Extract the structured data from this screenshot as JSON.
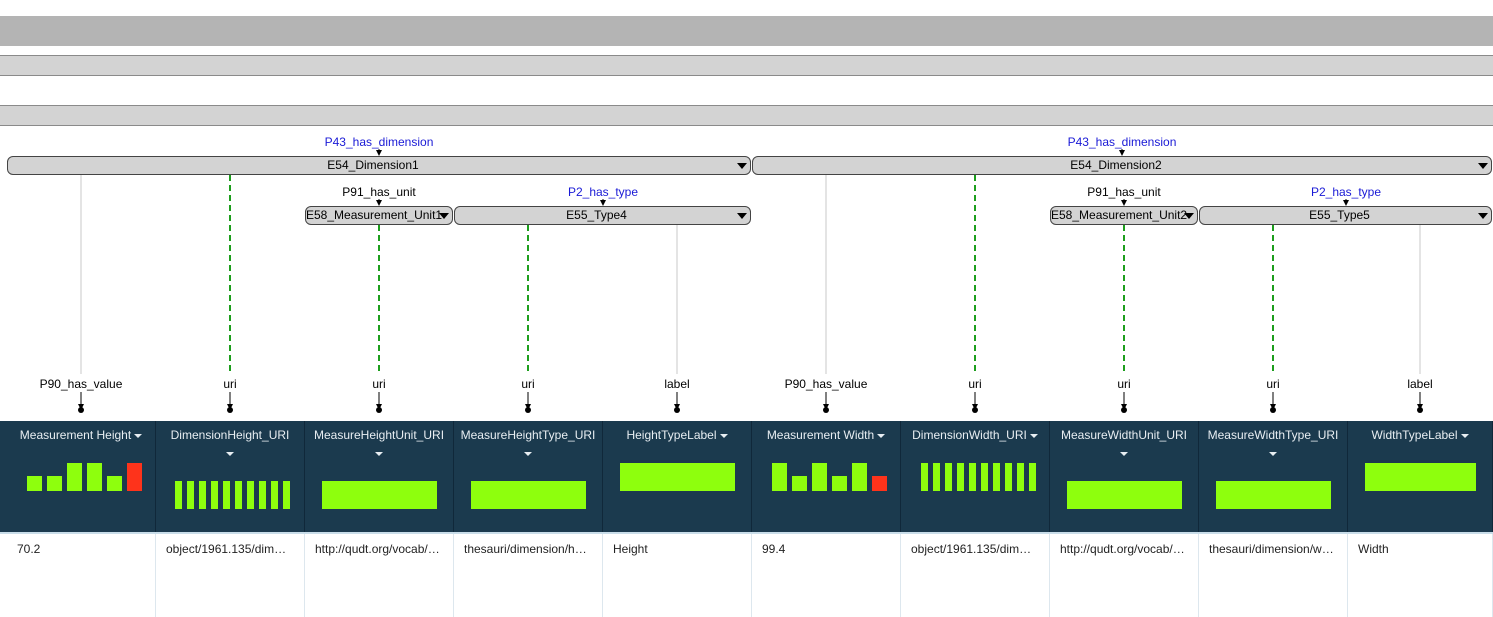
{
  "colors": {
    "header_bg": "#1b3a4e",
    "bar_green": "#8eff0d",
    "bar_red": "#fe331b",
    "link_blue": "#1a1ad6",
    "dashed_green": "#1d9e1d"
  },
  "nodes": [
    {
      "id": "E54_Dimension1",
      "label": "E54_Dimension1"
    },
    {
      "id": "E54_Dimension2",
      "label": "E54_Dimension2"
    },
    {
      "id": "E58_Measurement_Unit1",
      "label": "E58_Measurement_Unit1"
    },
    {
      "id": "E55_Type4",
      "label": "E55_Type4"
    },
    {
      "id": "E58_Measurement_Unit2",
      "label": "E58_Measurement_Unit2"
    },
    {
      "id": "E55_Type5",
      "label": "E55_Type5"
    }
  ],
  "edge_labels": {
    "dim1_has_dimension": "P43_has_dimension",
    "dim2_has_dimension": "P43_has_dimension",
    "unit1": "P91_has_unit",
    "type4": "P2_has_type",
    "unit2": "P91_has_unit",
    "type5": "P2_has_type"
  },
  "column_links": [
    "P90_has_value",
    "uri",
    "uri",
    "uri",
    "label",
    "P90_has_value",
    "uri",
    "uri",
    "uri",
    "label"
  ],
  "columns": [
    {
      "title": "Measurement Height",
      "value": "70.2",
      "histogram": [
        "green",
        "green",
        "green",
        "green",
        "green",
        "red"
      ]
    },
    {
      "title": "DimensionHeight_URI",
      "value": "object/1961.135/dim…",
      "histogram": [
        "green",
        "green",
        "green",
        "green",
        "green",
        "green",
        "green",
        "green",
        "green",
        "green"
      ]
    },
    {
      "title": "MeasureHeightUnit_URI",
      "value": "http://qudt.org/vocab/…",
      "histogram": [
        "green"
      ]
    },
    {
      "title": "MeasureHeightType_URI",
      "value": "thesauri/dimension/h…",
      "histogram": [
        "green"
      ]
    },
    {
      "title": "HeightTypeLabel",
      "value": "Height",
      "histogram": [
        "green"
      ]
    },
    {
      "title": "Measurement Width",
      "value": "99.4",
      "histogram": [
        "green",
        "green",
        "green",
        "green",
        "green",
        "red"
      ]
    },
    {
      "title": "DimensionWidth_URI",
      "value": "object/1961.135/dim…",
      "histogram": [
        "green",
        "green",
        "green",
        "green",
        "green",
        "green",
        "green",
        "green",
        "green",
        "green"
      ]
    },
    {
      "title": "MeasureWidthUnit_URI",
      "value": "http://qudt.org/vocab/…",
      "histogram": [
        "green"
      ]
    },
    {
      "title": "MeasureWidthType_URI",
      "value": "thesauri/dimension/w…",
      "histogram": [
        "green"
      ]
    },
    {
      "title": "WidthTypeLabel",
      "value": "Width",
      "histogram": [
        "green"
      ]
    }
  ]
}
